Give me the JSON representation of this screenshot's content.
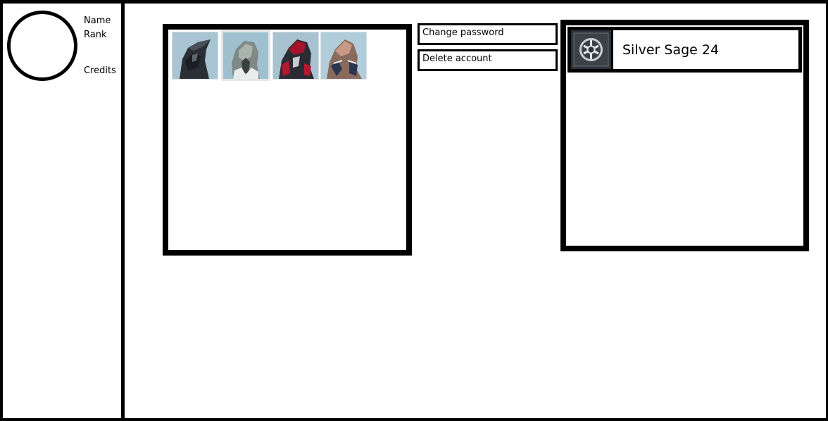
{
  "profile": {
    "name_label": "Name",
    "rank_label": "Rank",
    "credits_label": "Credits",
    "avatar_icon": "avatar-circle"
  },
  "skins": [
    {
      "icon": "warframe-portrait-dark-icon",
      "selected": false
    },
    {
      "icon": "warframe-portrait-grey-icon",
      "selected": true
    },
    {
      "icon": "warframe-portrait-red-icon",
      "selected": false
    },
    {
      "icon": "warframe-portrait-bronze-icon",
      "selected": false
    }
  ],
  "actions": {
    "change_password": "Change password",
    "delete_account": "Delete account"
  },
  "clan": {
    "name": "Silver Sage 24",
    "emblem_icon": "clan-emblem-icon"
  },
  "colors": {
    "border": "#000000",
    "background": "#ffffff",
    "portrait_sky": "#b9d6e4",
    "emblem_bg": "#2d3338"
  }
}
